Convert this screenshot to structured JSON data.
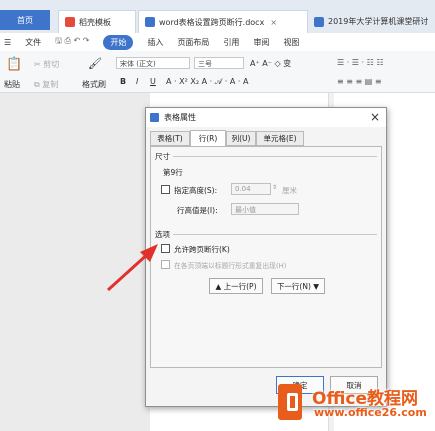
{
  "tabs": {
    "home": "首页",
    "straw": "稻壳模板",
    "doc1": "word表格设置跨页断行.docx",
    "doc2": "2019年大学计算机课堂研讨"
  },
  "menu": {
    "file": "文件",
    "start": "开始",
    "items": [
      "插入",
      "页面布局",
      "引用",
      "审阅",
      "视图"
    ]
  },
  "ribbon": {
    "paste": "粘贴",
    "cut": "剪切",
    "copy": "复制",
    "format_painter": "格式刷",
    "font_name": "宋体 (正文)",
    "font_size": "三号"
  },
  "dialog": {
    "title": "表格属性",
    "tabs": [
      "表格(T)",
      "行(R)",
      "列(U)",
      "单元格(E)"
    ],
    "size_section": "尺寸",
    "row_label": "第9行",
    "specify_height": "指定高度(S):",
    "height_value": "0.04",
    "height_unit": "厘米",
    "row_height_label": "行高值是(I):",
    "row_height_value": "最小值",
    "options_section": "选项",
    "allow_break": "允许跨页断行(K)",
    "repeat_header": "在各页顶端以标题行形式重复出现(H)",
    "prev_row": "▲ 上一行(P)",
    "next_row": "下一行(N) ▼",
    "ok": "确定",
    "cancel": "取消"
  },
  "watermark": {
    "brand": "Office教程网",
    "url": "www.office26.com"
  },
  "colors": {
    "accent": "#3e74c9",
    "arrow": "#e0322a",
    "logo_orange": "#e85d1b"
  }
}
